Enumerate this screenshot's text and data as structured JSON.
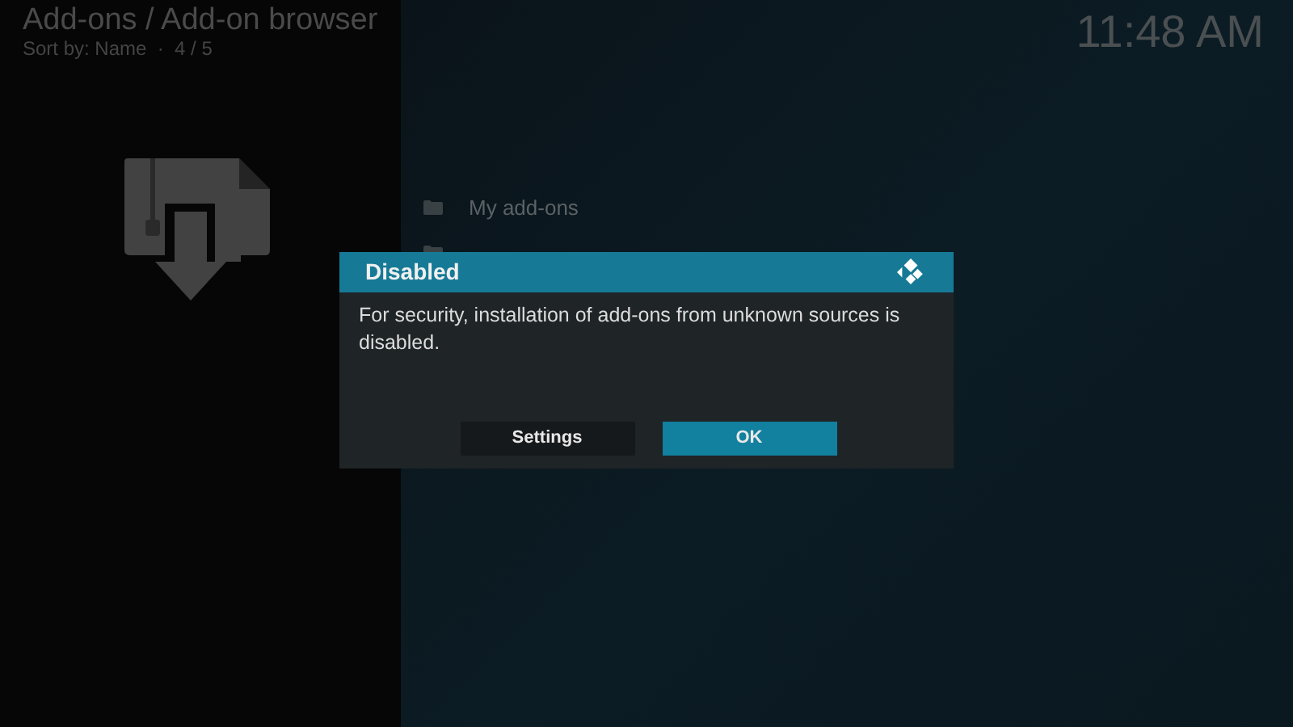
{
  "header": {
    "breadcrumb": "Add-ons / Add-on browser",
    "sort_info": "Sort by: Name  ·  4 / 5",
    "clock": "11:48 AM"
  },
  "menu_items": [
    {
      "label": "My add-ons"
    }
  ],
  "dialog": {
    "title": "Disabled",
    "message": "For security, installation of add-ons from unknown sources is disabled.",
    "buttons": [
      {
        "label": "Settings",
        "selected": false
      },
      {
        "label": "OK",
        "selected": true
      }
    ]
  }
}
